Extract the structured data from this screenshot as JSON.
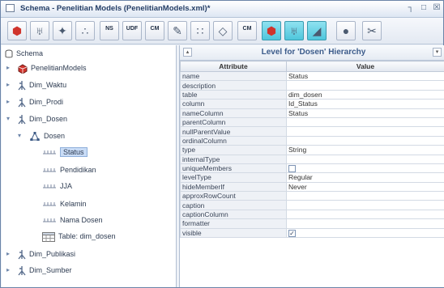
{
  "window": {
    "title": "Schema - Penelitian Models (PenelitianModels.xml)*"
  },
  "toolbar": {
    "buttons": [
      {
        "name": "add-cube-button",
        "icon": "cube-icon",
        "glyph": "⬢"
      },
      {
        "name": "add-dimension-button",
        "icon": "dimension-icon",
        "glyph": "♅"
      },
      {
        "name": "add-dimension-usage-button",
        "icon": "dimension-usage-icon",
        "glyph": "✦"
      },
      {
        "name": "add-hierarchy-button",
        "icon": "hierarchy-icon",
        "glyph": "∴"
      },
      {
        "name": "add-named-set-button",
        "icon": "named-set-icon",
        "label": "NS"
      },
      {
        "name": "add-udf-button",
        "icon": "udf-icon",
        "label": "UDF"
      },
      {
        "name": "add-calculated-member-button",
        "icon": "calculated-member-icon",
        "label": "CM"
      },
      {
        "name": "add-measure-button",
        "icon": "measure-icon",
        "glyph": "✎"
      },
      {
        "name": "add-level-button",
        "icon": "level-icon",
        "glyph": "∷"
      },
      {
        "name": "add-property-button",
        "icon": "property-icon",
        "glyph": "◇"
      },
      {
        "name": "add-virtual-cube-button",
        "icon": "virtual-cube-icon",
        "label": "CM"
      },
      {
        "name": "cube-view-button",
        "icon": "cube-view-icon",
        "glyph": "⬢",
        "selected": true
      },
      {
        "name": "dimension-view-button",
        "icon": "dimension-view-icon",
        "glyph": "♅",
        "selected": true
      },
      {
        "name": "edit-mode-button",
        "icon": "edit-mode-icon",
        "glyph": "◢",
        "selected": true
      },
      {
        "name": "add-role-button",
        "icon": "role-icon",
        "glyph": "●"
      },
      {
        "name": "delete-button",
        "icon": "delete-icon",
        "glyph": "✂"
      }
    ]
  },
  "tree": {
    "root": "Schema",
    "nodes": [
      {
        "label": "PenelitianModels",
        "icon": "cube-icon"
      },
      {
        "label": "Dim_Waktu",
        "icon": "dimension-icon"
      },
      {
        "label": "Dim_Prodi",
        "icon": "dimension-icon"
      },
      {
        "label": "Dim_Dosen",
        "icon": "dimension-icon"
      },
      {
        "label": "Dosen",
        "icon": "hierarchy-icon"
      },
      {
        "label": "Status",
        "icon": "level-icon",
        "selected": true
      },
      {
        "label": "Pendidikan",
        "icon": "level-icon"
      },
      {
        "label": "JJA",
        "icon": "level-icon"
      },
      {
        "label": "Kelamin",
        "icon": "level-icon"
      },
      {
        "label": "Nama Dosen",
        "icon": "level-icon"
      },
      {
        "label": "Table: dim_dosen",
        "icon": "table-icon"
      },
      {
        "label": "Dim_Publikasi",
        "icon": "dimension-icon"
      },
      {
        "label": "Dim_Sumber",
        "icon": "dimension-icon"
      }
    ]
  },
  "panel": {
    "heading": "Level for 'Dosen' Hierarchy",
    "col_attribute": "Attribute",
    "col_value": "Value",
    "rows": [
      {
        "attr": "name",
        "value": "Status"
      },
      {
        "attr": "description",
        "value": ""
      },
      {
        "attr": "table",
        "value": "dim_dosen"
      },
      {
        "attr": "column",
        "value": "Id_Status"
      },
      {
        "attr": "nameColumn",
        "value": "Status"
      },
      {
        "attr": "parentColumn",
        "value": ""
      },
      {
        "attr": "nullParentValue",
        "value": ""
      },
      {
        "attr": "ordinalColumn",
        "value": ""
      },
      {
        "attr": "type",
        "value": "String"
      },
      {
        "attr": "internalType",
        "value": ""
      },
      {
        "attr": "uniqueMembers",
        "value": "",
        "checkbox": true,
        "checked": false
      },
      {
        "attr": "levelType",
        "value": "Regular"
      },
      {
        "attr": "hideMemberIf",
        "value": "Never"
      },
      {
        "attr": "approxRowCount",
        "value": ""
      },
      {
        "attr": "caption",
        "value": ""
      },
      {
        "attr": "captionColumn",
        "value": ""
      },
      {
        "attr": "formatter",
        "value": ""
      },
      {
        "attr": "visible",
        "value": "",
        "checkbox": true,
        "checked": true
      }
    ]
  },
  "colors": {
    "cube": "#d0342c",
    "dimension": "#5b6f8e",
    "hierarchy": "#3d5b86",
    "level": "#7c8aa1",
    "selected_bg": "#c9dcf6",
    "heading": "#3b5b8a"
  }
}
